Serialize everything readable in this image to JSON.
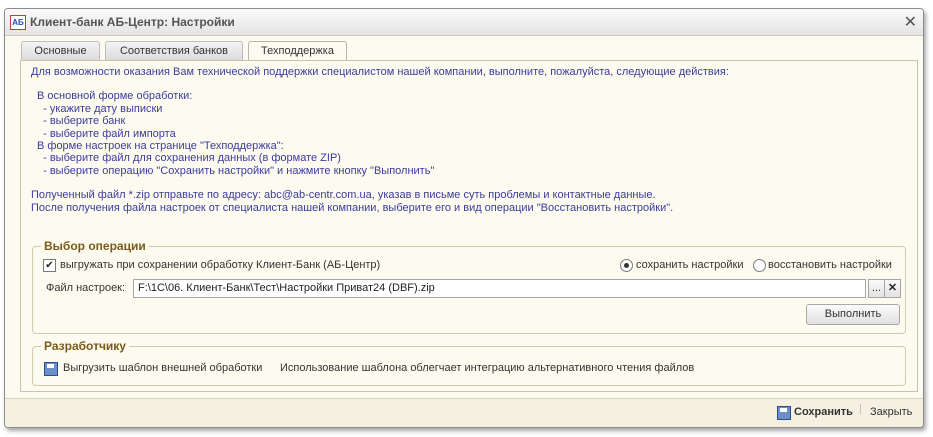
{
  "window": {
    "icon_text": "АБ",
    "title": "Клиент-банк АБ-Центр: Настройки",
    "close_glyph": "✕"
  },
  "tabs": [
    {
      "label": "Основные"
    },
    {
      "label": "Соответствия банков"
    },
    {
      "label": "Техподдержка"
    }
  ],
  "info": {
    "line1": "Для возможности оказания Вам технической поддержки специалистом нашей компании, выполните, пожалуйста, следующие действия:",
    "line2": "В основной форме обработки:",
    "line3": "  - укажите дату выписки",
    "line4": "  - выберите банк",
    "line5": "  - выберите файл импорта",
    "line6": "В форме настроек на странице \"Техподдержка\":",
    "line7": "  - выберите файл для сохранения данных (в формате ZIP)",
    "line8": "  - выберите операцию \"Сохранить настройки\" и нажмите кнопку \"Выполнить\"",
    "line9": "Полученный файл *.zip отправьте по адресу: abc@ab-centr.com.ua, указав в письме суть проблемы и контактные данные.",
    "line10": "После получения файла настроек от специалиста нашей компании, выберите его и вид операции \"Восстановить настройки\"."
  },
  "operation": {
    "title": "Выбор операции",
    "checkbox_label": "выгружать при сохранении обработку Клиент-Банк (АБ-Центр)",
    "checkbox_checked": true,
    "radio_save": "сохранить настройки",
    "radio_restore": "восстановить настройки",
    "selected": "save",
    "file_label": "Файл настроек:",
    "file_value": "F:\\1C\\06. Клиент-Банк\\Тест\\Настройки Приват24 (DBF).zip",
    "browse_glyph": "...",
    "clear_glyph": "✕",
    "execute_label": "Выполнить"
  },
  "developer": {
    "title": "Разработчику",
    "export_label": "Выгрузить шаблон внешней обработки",
    "export_hint": "Использование шаблона облегчает интеграцию альтернативного чтения файлов"
  },
  "footer": {
    "save_label": "Сохранить",
    "close_label": "Закрыть"
  }
}
